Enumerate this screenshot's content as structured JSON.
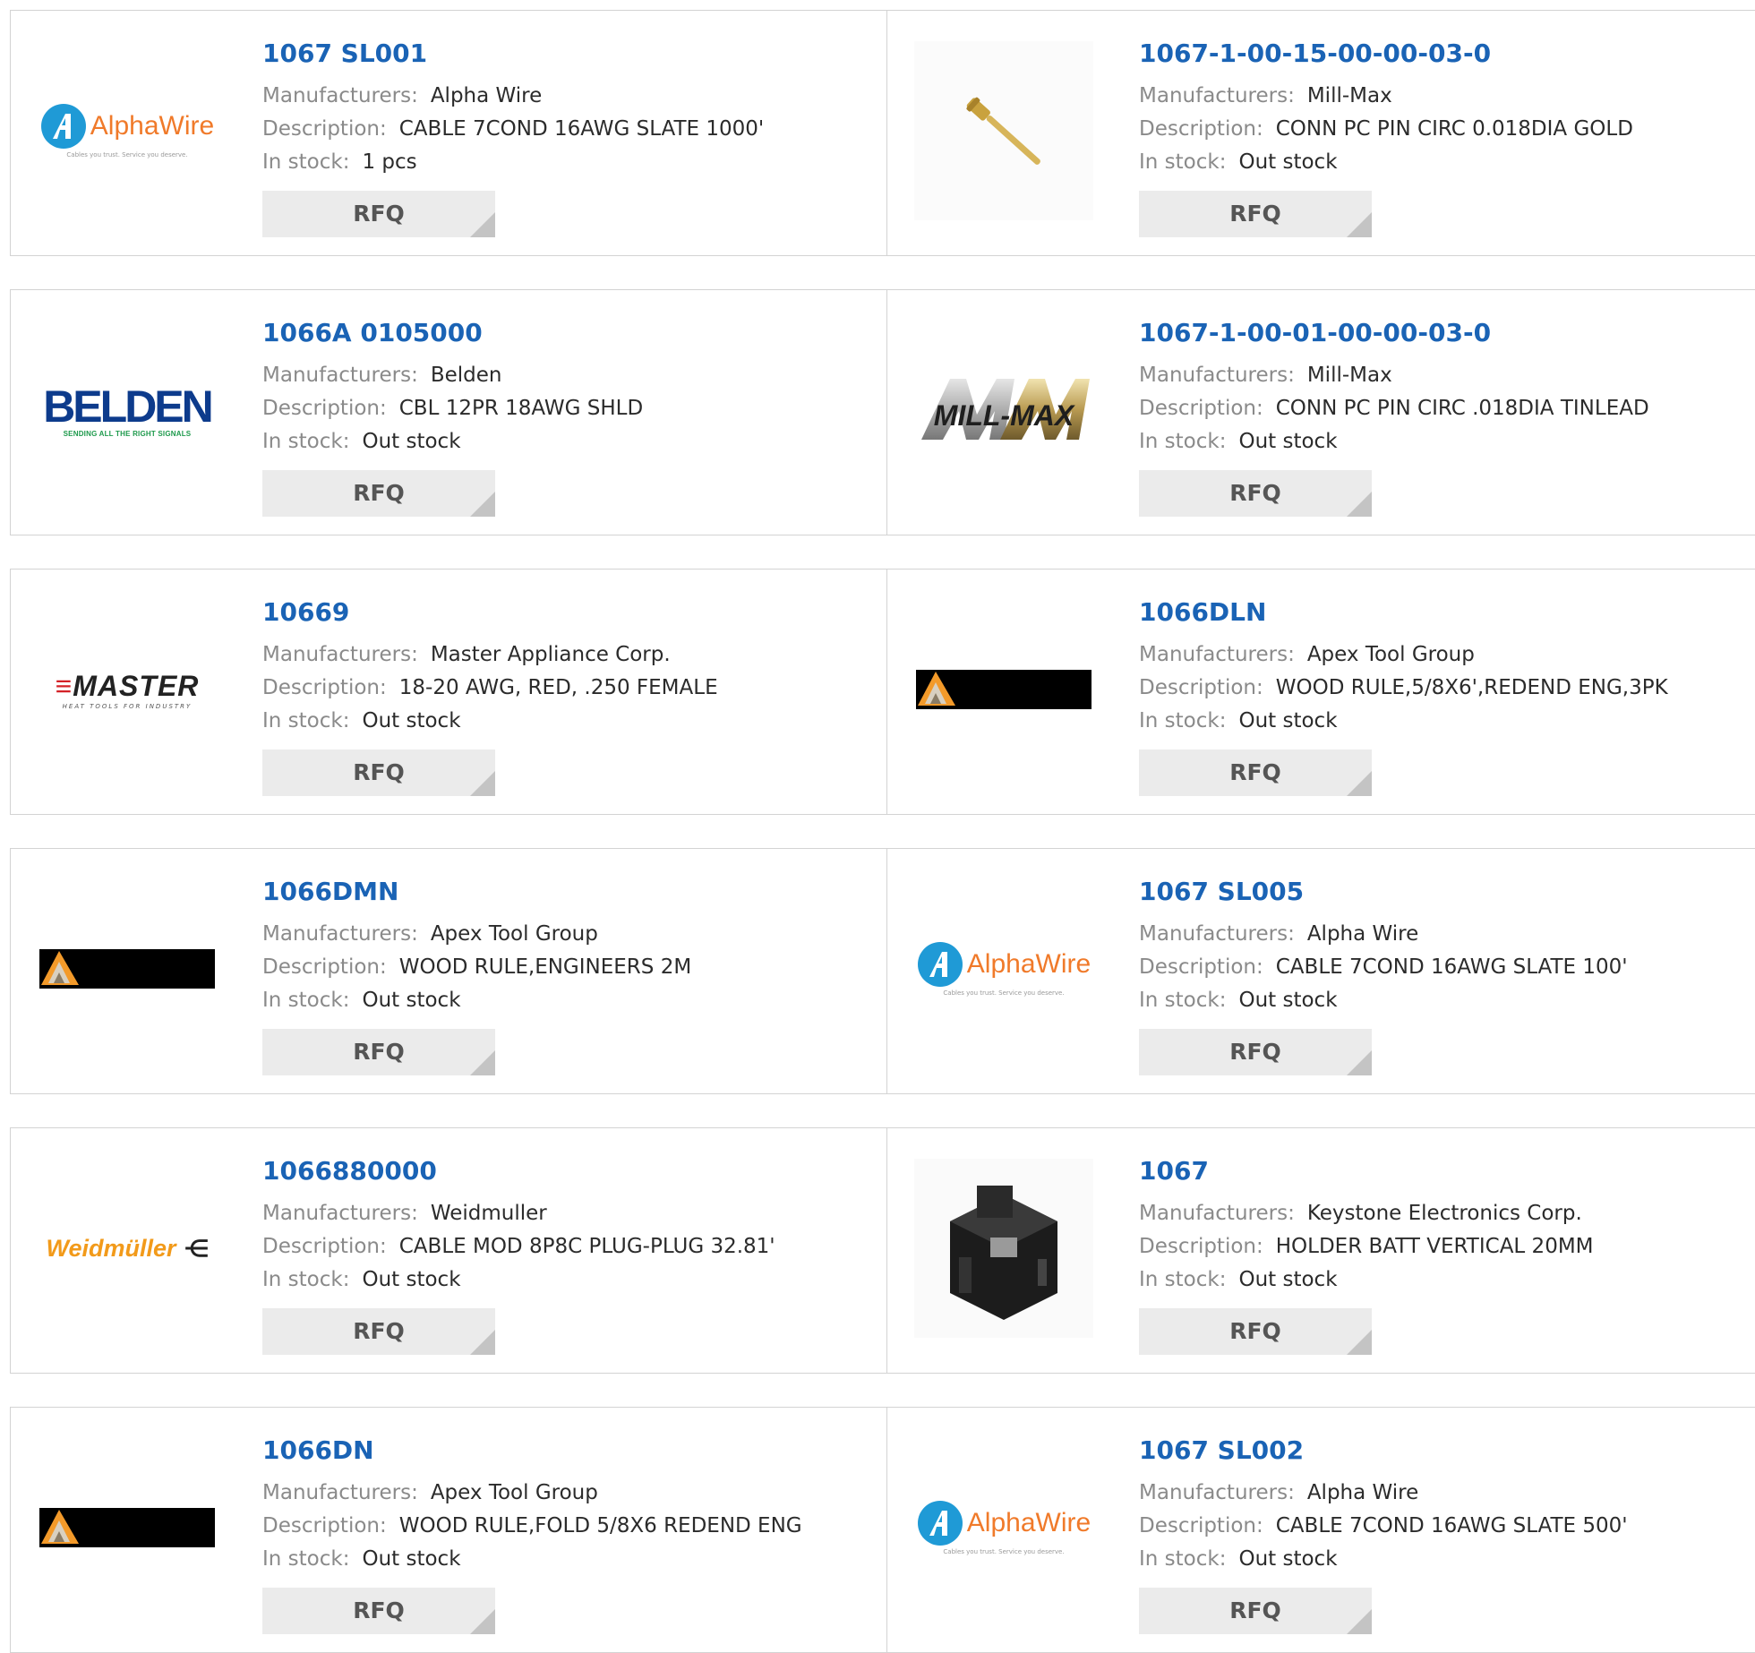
{
  "labels": {
    "manufacturers": "Manufacturers:",
    "description": "Description:",
    "in_stock": "In stock:",
    "rfq": "RFQ"
  },
  "products": [
    {
      "part_number": "1067 SL001",
      "manufacturer": "Alpha Wire",
      "description": "CABLE 7COND 16AWG SLATE 1000'",
      "stock": "1 pcs",
      "logo": "alphawire-logo"
    },
    {
      "part_number": "1067-1-00-15-00-00-03-0",
      "manufacturer": "Mill-Max",
      "description": "CONN PC PIN CIRC 0.018DIA GOLD",
      "stock": "Out stock",
      "logo": "pin-product-image"
    },
    {
      "part_number": "1066A 0105000",
      "manufacturer": "Belden",
      "description": "CBL 12PR 18AWG SHLD",
      "stock": "Out stock",
      "logo": "belden-logo"
    },
    {
      "part_number": "1067-1-00-01-00-00-03-0",
      "manufacturer": "Mill-Max",
      "description": "CONN PC PIN CIRC .018DIA TINLEAD",
      "stock": "Out stock",
      "logo": "millmax-logo"
    },
    {
      "part_number": "10669",
      "manufacturer": "Master Appliance Corp.",
      "description": "18-20 AWG, RED, .250 FEMALE",
      "stock": "Out stock",
      "logo": "master-logo"
    },
    {
      "part_number": "1066DLN",
      "manufacturer": "Apex Tool Group",
      "description": "WOOD RULE,5/8X6',REDEND ENG,3PK",
      "stock": "Out stock",
      "logo": "apex-logo"
    },
    {
      "part_number": "1066DMN",
      "manufacturer": "Apex Tool Group",
      "description": "WOOD RULE,ENGINEERS 2M",
      "stock": "Out stock",
      "logo": "apex-logo"
    },
    {
      "part_number": "1067 SL005",
      "manufacturer": "Alpha Wire",
      "description": "CABLE 7COND 16AWG SLATE 100'",
      "stock": "Out stock",
      "logo": "alphawire-logo"
    },
    {
      "part_number": "1066880000",
      "manufacturer": "Weidmuller",
      "description": "CABLE MOD 8P8C PLUG-PLUG 32.81'",
      "stock": "Out stock",
      "logo": "weidmuller-logo"
    },
    {
      "part_number": "1067",
      "manufacturer": "Keystone Electronics Corp.",
      "description": "HOLDER BATT VERTICAL 20MM",
      "stock": "Out stock",
      "logo": "battery-holder-image"
    },
    {
      "part_number": "1066DN",
      "manufacturer": "Apex Tool Group",
      "description": "WOOD RULE,FOLD 5/8X6 REDEND ENG",
      "stock": "Out stock",
      "logo": "apex-logo"
    },
    {
      "part_number": "1067 SL002",
      "manufacturer": "Alpha Wire",
      "description": "CABLE 7COND 16AWG SLATE 500'",
      "stock": "Out stock",
      "logo": "alphawire-logo"
    }
  ],
  "logo_text": {
    "alphawire": {
      "word": "AlphaWire",
      "tagline": "Cables you trust. Service you deserve."
    },
    "belden": {
      "word": "BELDEN",
      "tagline": "SENDING ALL THE RIGHT SIGNALS"
    },
    "master": {
      "word": "MASTER",
      "tagline": "HEAT TOOLS FOR INDUSTRY"
    },
    "millmax": {
      "word": "MILL-MAX"
    },
    "weidmuller": {
      "word": "Weidmüller"
    }
  },
  "colors": {
    "part_number": "#1a63b5",
    "label": "#8a8a8a",
    "value": "#2b2b2b",
    "rfq_bg": "#ebebeb",
    "rfq_text": "#555555",
    "border": "#d3d3d3"
  }
}
